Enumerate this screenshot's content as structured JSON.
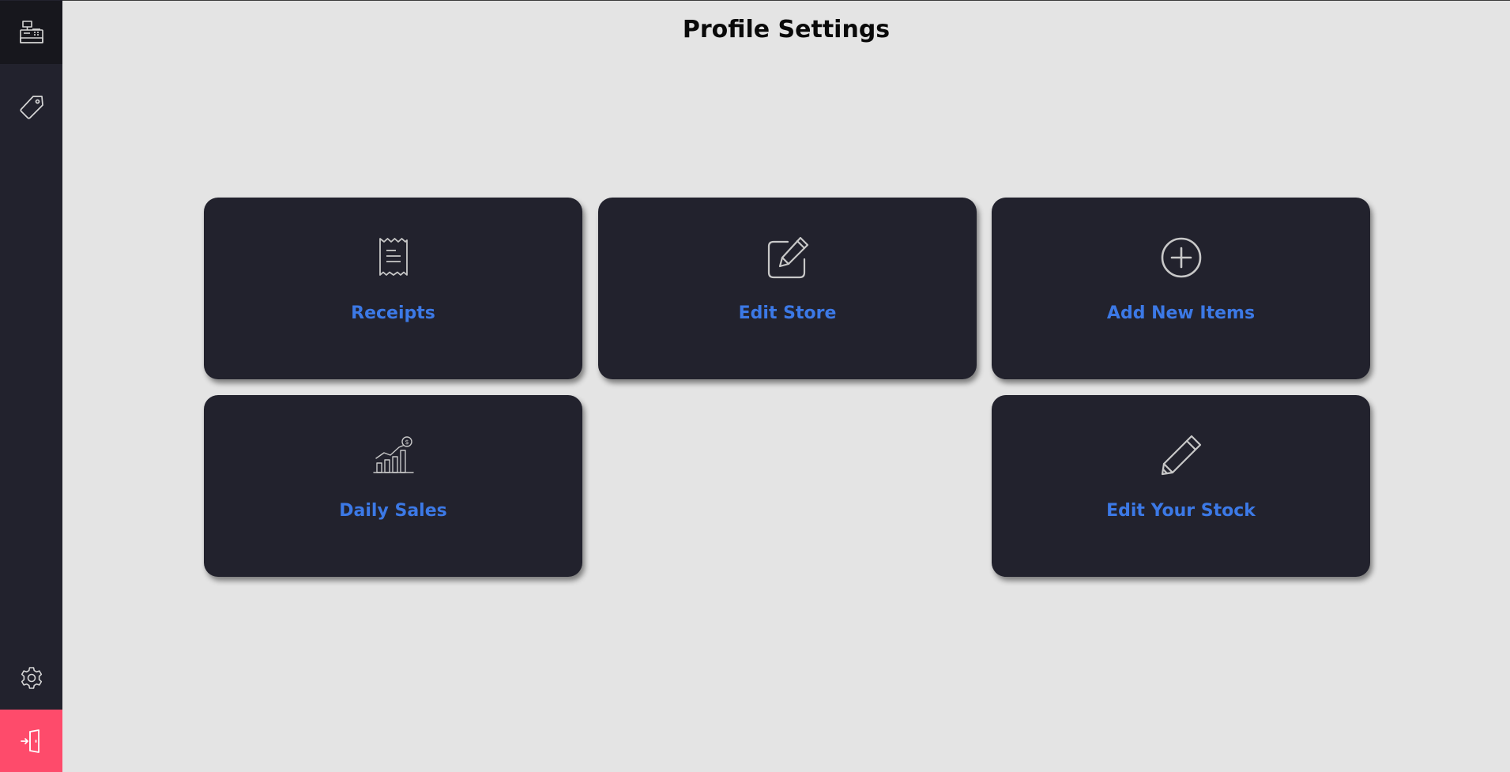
{
  "header": {
    "title": "Profile Settings"
  },
  "sidebar": {
    "items": [
      {
        "name": "pos",
        "icon": "cash-register-icon"
      },
      {
        "name": "tags",
        "icon": "price-tag-icon"
      },
      {
        "name": "settings",
        "icon": "gear-icon"
      },
      {
        "name": "logout",
        "icon": "logout-door-icon"
      }
    ],
    "logout_color": "#fe4b6b"
  },
  "cards": [
    {
      "label": "Receipts",
      "icon": "receipt-icon"
    },
    {
      "label": "Edit Store",
      "icon": "edit-square-icon"
    },
    {
      "label": "Add New Items",
      "icon": "plus-circle-icon"
    },
    {
      "label": "Daily Sales",
      "icon": "sales-chart-icon"
    },
    {
      "label": "Edit Your Stock",
      "icon": "pencil-icon"
    }
  ],
  "colors": {
    "background": "#e4e4e4",
    "card": "#22222d",
    "accent_label": "#3c79e6"
  }
}
